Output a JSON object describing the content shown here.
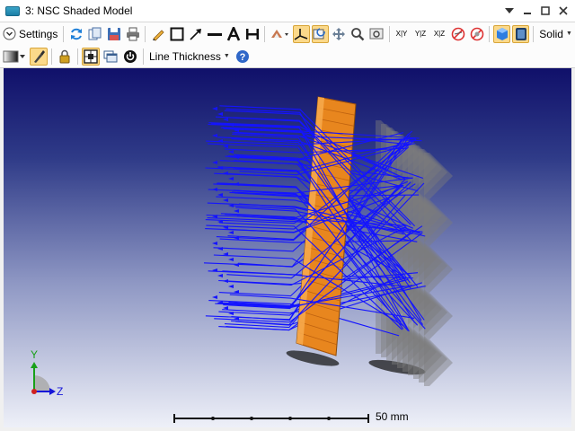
{
  "window": {
    "title": "3: NSC Shaded Model",
    "controls": [
      "dropdown-icon",
      "minimize-icon",
      "maximize-icon",
      "close-icon"
    ]
  },
  "toolbar1": {
    "settings_label": "Settings",
    "tools": [
      "refresh-icon",
      "copy-icon",
      "save-icon",
      "print-icon",
      "pencil-icon",
      "rectangle-icon",
      "arrow-icon",
      "line-icon",
      "text-icon",
      "dimension-icon",
      "rotate-3d-icon",
      "axes-icon",
      "reset-view-icon",
      "pan-icon",
      "zoom-icon",
      "fit-icon",
      "xy-view-icon",
      "yz-view-icon",
      "xz-view-icon",
      "no-rays-icon",
      "no-objects-icon",
      "solid-shade-icon",
      "box-shade-icon"
    ],
    "xy_label": "X|Y",
    "yz_label": "Y|Z",
    "xz_label": "X|Z",
    "solid_label": "Solid"
  },
  "toolbar2": {
    "tools": [
      "background-gradient-icon",
      "highlight-icon",
      "lock-icon",
      "frame-icon",
      "window-icon",
      "power-icon"
    ],
    "line_thickness_label": "Line Thickness",
    "help": "help-icon"
  },
  "viewport": {
    "axes": {
      "y": "Y",
      "z": "Z"
    },
    "scale_label": "50 mm",
    "colors": {
      "rays": "#1414ff",
      "lens": "#e8861e",
      "detector": "#7c7c7c",
      "bg_top": "#10106a",
      "bg_bottom": "#eef0f8"
    }
  }
}
